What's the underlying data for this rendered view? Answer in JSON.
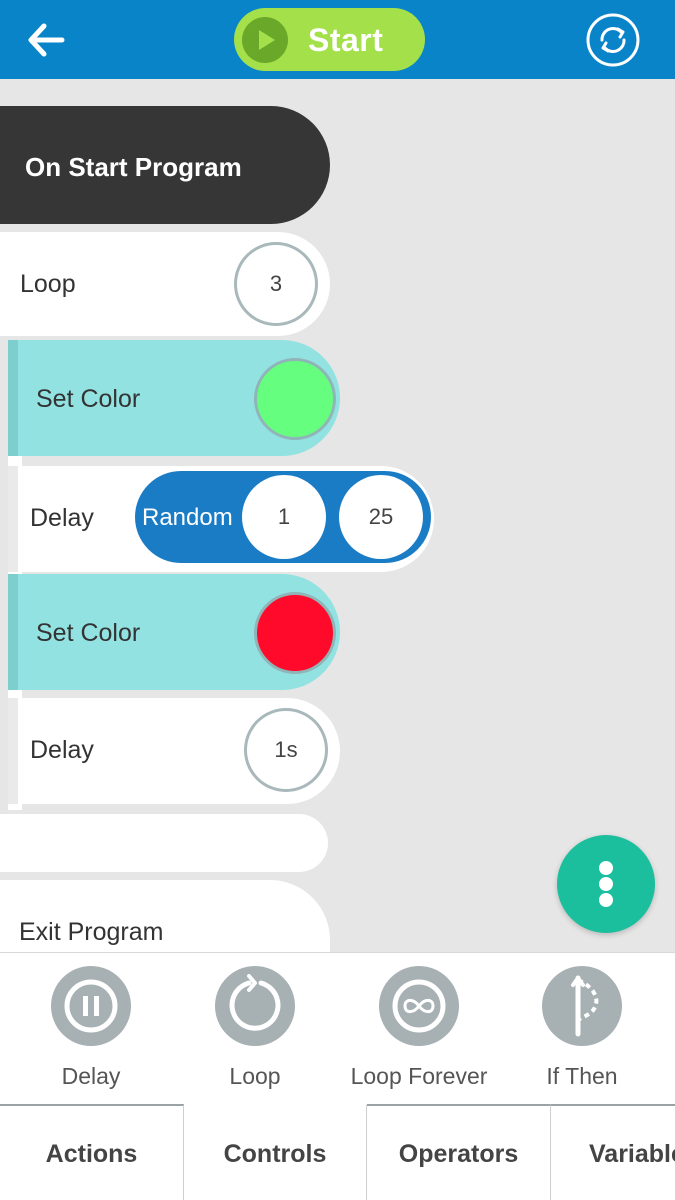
{
  "header": {
    "back_icon": "arrow-left-icon",
    "start_label": "Start",
    "start_icon": "play-icon",
    "sync_icon": "sync-icon"
  },
  "program": {
    "on_start": "On Start Program",
    "loop": {
      "label": "Loop",
      "count": "3"
    },
    "set_color_1": {
      "label": "Set Color",
      "color": "#66fe7f"
    },
    "delay_random": {
      "label": "Delay",
      "mode": "Random",
      "min": "1",
      "max": "25"
    },
    "set_color_2": {
      "label": "Set Color",
      "color": "#ff0a2a"
    },
    "delay_fixed": {
      "label": "Delay",
      "value": "1s"
    },
    "exit": "Exit Program"
  },
  "fab": {
    "icon": "more-vertical-icon"
  },
  "palette": {
    "items": [
      {
        "label": "Delay",
        "icon": "pause-icon"
      },
      {
        "label": "Loop",
        "icon": "loop-icon"
      },
      {
        "label": "Loop Forever",
        "icon": "infinity-icon"
      },
      {
        "label": "If Then",
        "icon": "branch-icon"
      }
    ]
  },
  "tabs": [
    {
      "label": "Actions"
    },
    {
      "label": "Controls",
      "active": true
    },
    {
      "label": "Operators"
    },
    {
      "label": "Variables"
    }
  ],
  "colors": {
    "topbar": "#0a84c9",
    "start_button": "#a3e04a",
    "set_color_block": "#93e2e2",
    "random_pill": "#1b7cc6",
    "fab": "#1bbf9e"
  }
}
